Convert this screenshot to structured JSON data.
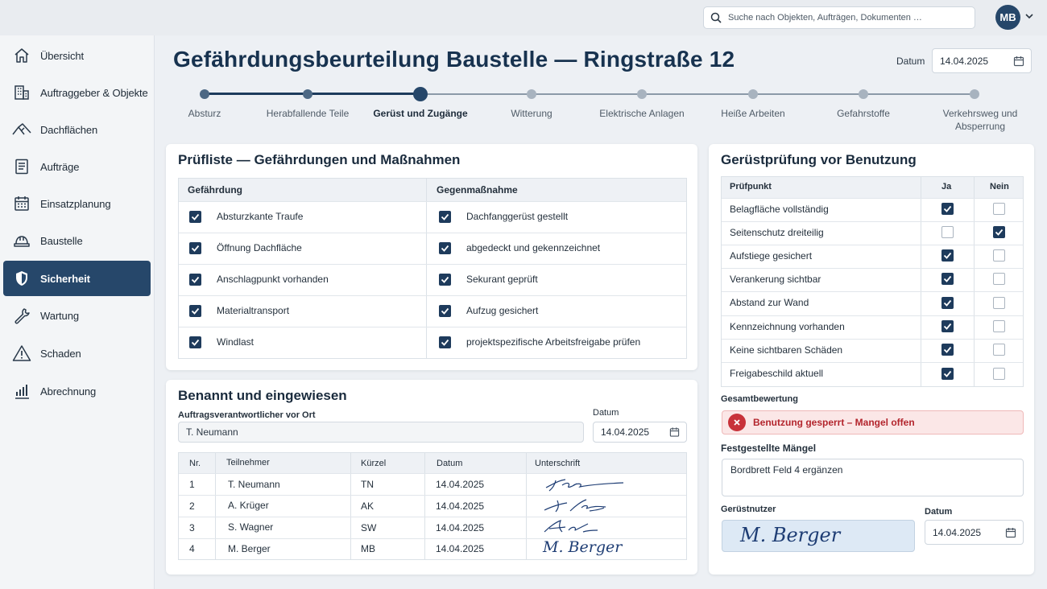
{
  "topbar": {
    "search_placeholder": "Suche nach Objekten, Aufträgen, Dokumenten …",
    "user_initials": "MB"
  },
  "sidebar": {
    "items": [
      {
        "label": "Übersicht",
        "icon": "home-icon"
      },
      {
        "label": "Auftraggeber & Objekte",
        "icon": "building-icon"
      },
      {
        "label": "Dachflächen",
        "icon": "roof-icon"
      },
      {
        "label": "Aufträge",
        "icon": "document-icon"
      },
      {
        "label": "Einsatzplanung",
        "icon": "calendar-icon"
      },
      {
        "label": "Baustelle",
        "icon": "hard-hat-icon"
      },
      {
        "label": "Sicherheit",
        "icon": "shield-icon",
        "active": true
      },
      {
        "label": "Wartung",
        "icon": "wrench-icon"
      },
      {
        "label": "Schaden",
        "icon": "warning-icon"
      },
      {
        "label": "Abrechnung",
        "icon": "bar-chart-icon"
      }
    ]
  },
  "header": {
    "title": "Gefährdungsbeurteilung Baustelle — Ringstraße 12",
    "date_label": "Datum",
    "date_value": "14.04.2025"
  },
  "stepper": {
    "current_index": 2,
    "steps": [
      "Absturz",
      "Herabfallende Teile",
      "Gerüst und Zugänge",
      "Witterung",
      "Elektrische Anlagen",
      "Heiße Arbeiten",
      "Gefahrstoffe",
      "Verkehrsweg und Absperrung"
    ]
  },
  "checklist": {
    "title": "Prüfliste — Gefährdungen und Maßnahmen",
    "col_hazard": "Gefährdung",
    "col_measure": "Gegenmaßnahme",
    "rows": [
      {
        "hazard": "Absturzkante Traufe",
        "hazard_checked": true,
        "measure": "Dachfanggerüst gestellt",
        "measure_checked": true
      },
      {
        "hazard": "Öffnung Dachfläche",
        "hazard_checked": true,
        "measure": "abgedeckt und gekennzeichnet",
        "measure_checked": true
      },
      {
        "hazard": "Anschlagpunkt vorhanden",
        "hazard_checked": true,
        "measure": "Sekurant geprüft",
        "measure_checked": true
      },
      {
        "hazard": "Materialtransport",
        "hazard_checked": true,
        "measure": "Aufzug gesichert",
        "measure_checked": true
      },
      {
        "hazard": "Windlast",
        "hazard_checked": true,
        "measure": "projektspezifische Arbeitsfreigabe prüfen",
        "measure_checked": true
      }
    ]
  },
  "briefing": {
    "title": "Benannt und eingewiesen",
    "responsible_label": "Auftragsverantwortlicher vor Ort",
    "responsible_value": "T. Neumann",
    "date_label": "Datum",
    "date_value": "14.04.2025",
    "columns": [
      "Nr.",
      "Teilnehmer",
      "Kürzel",
      "Datum",
      "Unterschrift"
    ],
    "rows": [
      {
        "nr": "1",
        "name": "T. Neumann",
        "short": "TN",
        "date": "14.04.2025",
        "signature": "Tha"
      },
      {
        "nr": "2",
        "name": "A. Krüger",
        "short": "AK",
        "date": "14.04.2025",
        "signature": "A.Kr"
      },
      {
        "nr": "3",
        "name": "S. Wagner",
        "short": "SW",
        "date": "14.04.2025",
        "signature": "Aeh"
      },
      {
        "nr": "4",
        "name": "M. Berger",
        "short": "MB",
        "date": "14.04.2025",
        "signature": "M. Berger"
      }
    ]
  },
  "scaffold": {
    "title": "Gerüstprüfung vor Benutzung",
    "col_point": "Prüfpunkt",
    "col_yes": "Ja",
    "col_no": "Nein",
    "rows": [
      {
        "label": "Belagfläche vollständig",
        "yes": true,
        "no": false
      },
      {
        "label": "Seitenschutz dreiteilig",
        "yes": false,
        "no": true
      },
      {
        "label": "Aufstiege gesichert",
        "yes": true,
        "no": false
      },
      {
        "label": "Verankerung sichtbar",
        "yes": true,
        "no": false
      },
      {
        "label": "Abstand zur Wand",
        "yes": true,
        "no": false
      },
      {
        "label": "Kennzeichnung vorhanden",
        "yes": true,
        "no": false
      },
      {
        "label": "Keine sichtbaren Schäden",
        "yes": true,
        "no": false
      },
      {
        "label": "Freigabeschild aktuell",
        "yes": true,
        "no": false
      }
    ],
    "overall_label": "Gesamtbewertung",
    "overall_status": "Benutzung gesperrt – Mangel offen",
    "defects_label": "Festgestellte Mängel",
    "defects_value": "Bordbrett Feld 4 ergänzen",
    "user_label": "Gerüstnutzer",
    "user_signature": "M. Berger",
    "date_label": "Datum",
    "date_value": "14.04.2025"
  },
  "colors": {
    "primary": "#26476a",
    "danger": "#c8323a",
    "danger_bg": "#fbe7e7"
  }
}
